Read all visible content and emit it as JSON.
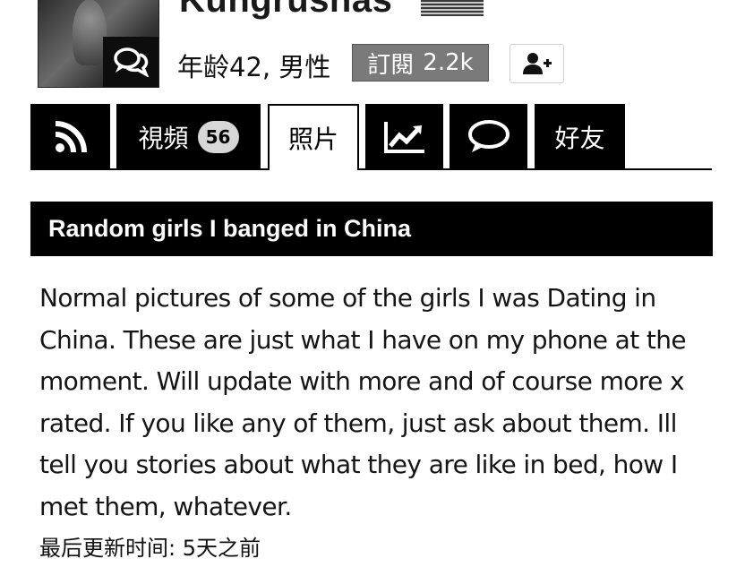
{
  "profile": {
    "username": "Kungrushas",
    "age_gender": "年龄42, 男性",
    "subscribe_label": "訂閱",
    "subscriber_count": "2.2k"
  },
  "tabs": [
    {
      "name": "feed",
      "icon": "rss-icon",
      "active": false
    },
    {
      "name": "videos",
      "label": "視頻",
      "count": "56",
      "active": false
    },
    {
      "name": "photos",
      "label": "照片",
      "active": true
    },
    {
      "name": "stats",
      "icon": "chart-line-icon",
      "active": false
    },
    {
      "name": "comments",
      "icon": "speech-bubble-icon",
      "active": false
    },
    {
      "name": "friends",
      "label": "好友",
      "active": false
    }
  ],
  "album": {
    "title": "Random girls I banged in China",
    "description": "Normal pictures of some of the girls I was Dating in China. These are just what I have on my phone at the moment. Will update with more and of course more x rated. If you like any of them, just ask about them. Ill tell you stories about what they are like in bed, how I met them, whatever.",
    "last_updated": "最后更新时间: 5天之前"
  },
  "colors": {
    "tab_background": "#000000",
    "subscribe_background": "#7a7a7a",
    "count_badge": "#d7d7d7"
  }
}
